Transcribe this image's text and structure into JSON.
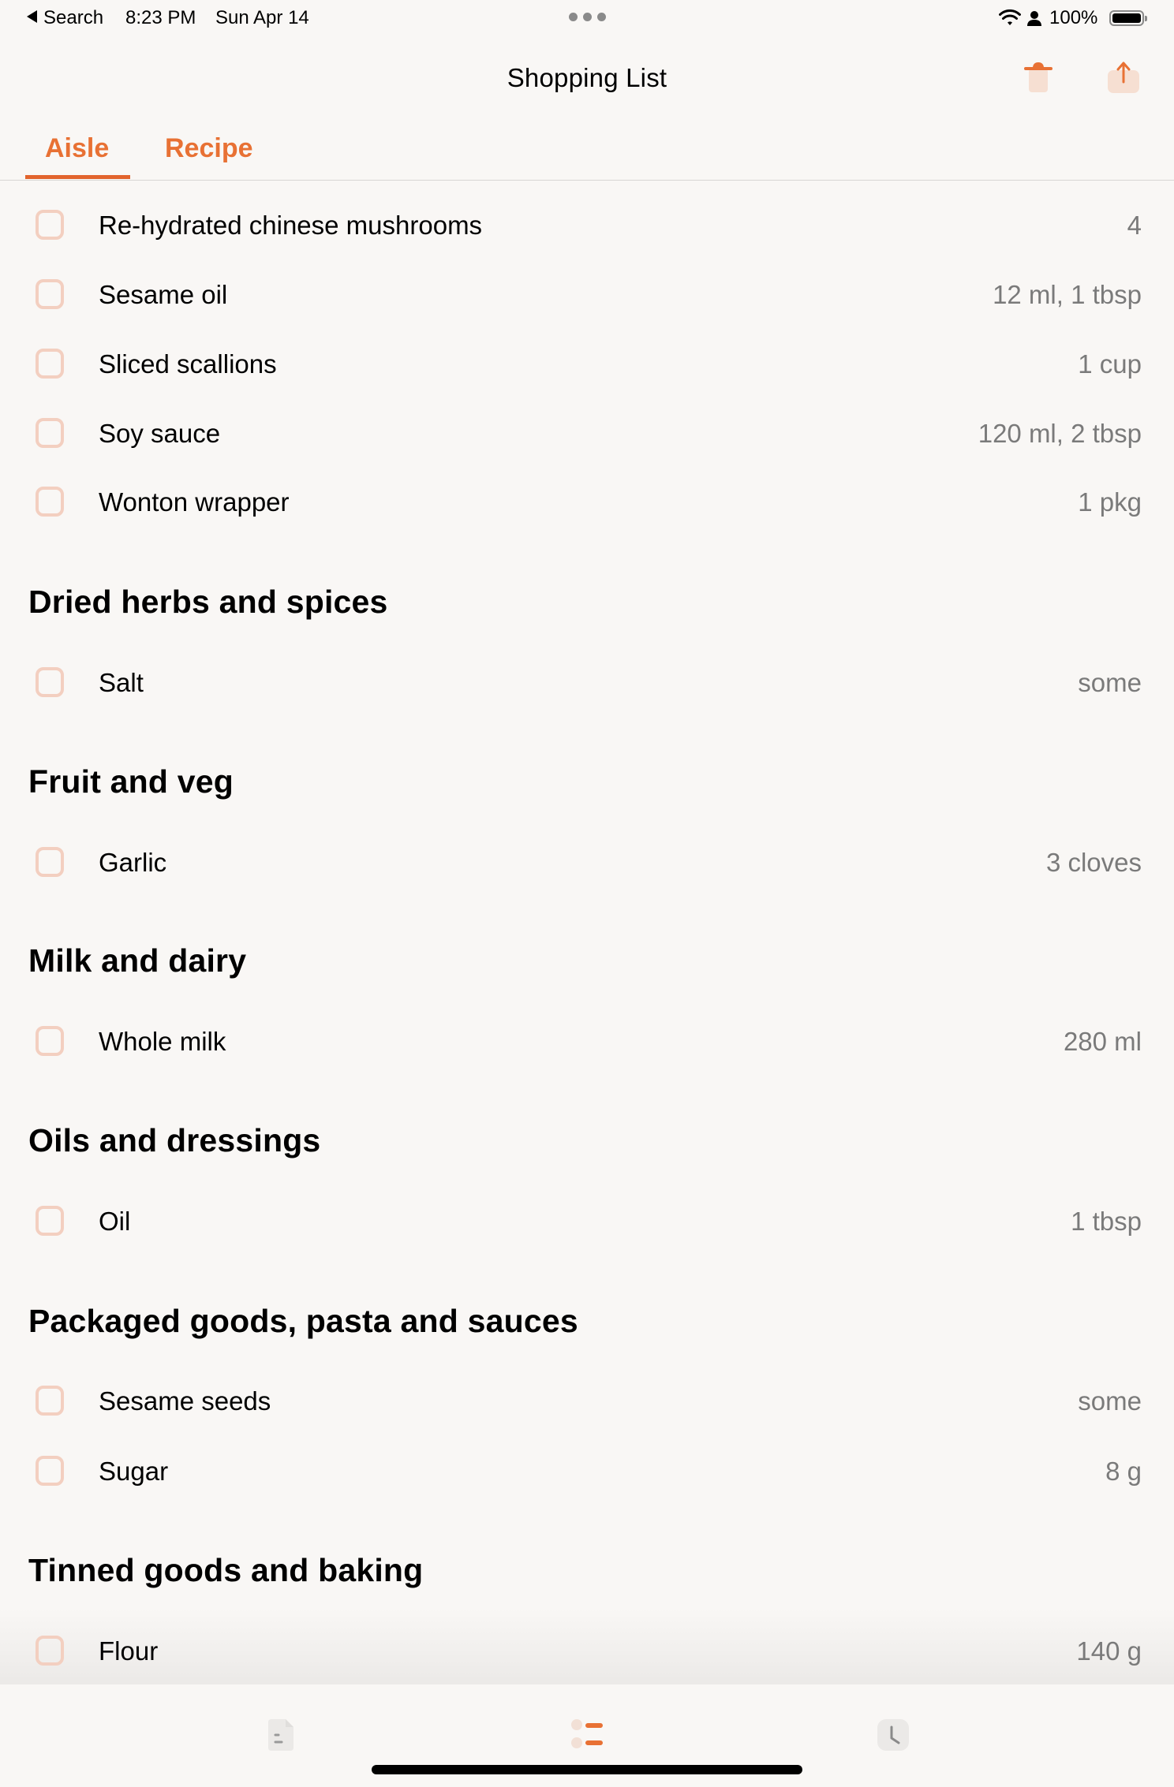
{
  "status_bar": {
    "back_label": "Search",
    "time": "8:23 PM",
    "date": "Sun Apr 14",
    "battery": "100%",
    "icons": [
      "wifi-icon",
      "person-icon",
      "battery-icon"
    ]
  },
  "header": {
    "title": "Shopping List",
    "actions": [
      {
        "name": "delete",
        "icon": "trash-icon"
      },
      {
        "name": "share",
        "icon": "share-icon"
      }
    ]
  },
  "tabs": [
    {
      "label": "Aisle",
      "selected": true
    },
    {
      "label": "Recipe",
      "selected": false
    }
  ],
  "colors": {
    "accent": "#e87134",
    "checkbox_border": "#f3cfc0",
    "quantity_text": "#7a7a7a",
    "background": "#f9f7f5"
  },
  "list": {
    "top_items": [
      {
        "name": "Re-hydrated chinese mushrooms",
        "qty": "4"
      },
      {
        "name": "Sesame oil",
        "qty": "12 ml, 1 tbsp"
      },
      {
        "name": "Sliced scallions",
        "qty": "1 cup"
      },
      {
        "name": "Soy sauce",
        "qty": "120 ml, 2 tbsp"
      },
      {
        "name": "Wonton wrapper",
        "qty": "1 pkg"
      }
    ],
    "sections": [
      {
        "heading": "Dried herbs and spices",
        "items": [
          {
            "name": "Salt",
            "qty": "some"
          }
        ]
      },
      {
        "heading": "Fruit and veg",
        "items": [
          {
            "name": "Garlic",
            "qty": "3 cloves"
          }
        ]
      },
      {
        "heading": "Milk and dairy",
        "items": [
          {
            "name": "Whole milk",
            "qty": "280 ml"
          }
        ]
      },
      {
        "heading": "Oils and dressings",
        "items": [
          {
            "name": "Oil",
            "qty": "1 tbsp"
          }
        ]
      },
      {
        "heading": "Packaged goods, pasta and sauces",
        "items": [
          {
            "name": "Sesame seeds",
            "qty": "some"
          },
          {
            "name": "Sugar",
            "qty": "8 g"
          }
        ]
      },
      {
        "heading": "Tinned goods and baking",
        "items": [
          {
            "name": "Flour",
            "qty": "140 g"
          }
        ]
      }
    ]
  },
  "tab_bar": [
    {
      "icon": "document-icon",
      "selected": false
    },
    {
      "icon": "list-icon",
      "selected": true
    },
    {
      "icon": "clock-icon",
      "selected": false
    }
  ]
}
